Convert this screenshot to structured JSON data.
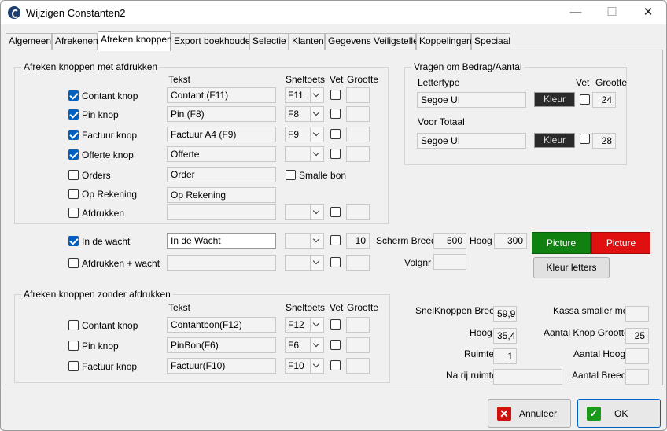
{
  "window": {
    "title": "Wijzigen Constanten2",
    "minimize": "—",
    "maximize": "☐",
    "close": "✕"
  },
  "tabs": [
    "Algemeen",
    "Afrekenen",
    "Afreken knoppen",
    "Export boekhouden",
    "Selectie",
    "Klanten",
    "Gegevens Veiligstellen",
    "Koppelingen",
    "Speciaal"
  ],
  "group1": {
    "title": "Afreken knoppen met afdrukken",
    "headers": {
      "tekst": "Tekst",
      "sneltoets": "Sneltoets",
      "vet": "Vet",
      "grootte": "Grootte"
    },
    "rows": [
      {
        "label": "Contant knop",
        "checked": true,
        "tekst": "Contant (F11)",
        "sneltoets": "F11"
      },
      {
        "label": "Pin knop",
        "checked": true,
        "tekst": "Pin (F8)",
        "sneltoets": "F8"
      },
      {
        "label": "Factuur knop",
        "checked": true,
        "tekst": "Factuur A4 (F9)",
        "sneltoets": "F9"
      },
      {
        "label": "Offerte knop",
        "checked": true,
        "tekst": "Offerte",
        "sneltoets": ""
      },
      {
        "label": "Orders",
        "checked": false,
        "tekst": "Order",
        "smalle_bon": "Smalle bon"
      },
      {
        "label": "Op Rekening",
        "checked": false,
        "tekst": "Op Rekening"
      },
      {
        "label": "Afdrukken",
        "checked": false,
        "tekst": "",
        "sneltoets": ""
      }
    ]
  },
  "wacht": {
    "row1": {
      "label": "In de wacht",
      "checked": true,
      "tekst": "In de Wacht",
      "grootte": "10"
    },
    "row2": {
      "label": "Afdrukken + wacht",
      "checked": false,
      "tekst": ""
    },
    "scherm_breed_label": "Scherm Breed",
    "scherm_breed": "500",
    "hoog_label": "Hoog",
    "hoog": "300",
    "volgnr_label": "Volgnr",
    "volgnr": "",
    "picture1": "Picture",
    "picture2": "Picture",
    "kleur_letters": "Kleur letters"
  },
  "vragen": {
    "title": "Vragen om Bedrag/Aantal",
    "lettertype_label": "Lettertype",
    "vet": "Vet",
    "grootte": "Grootte",
    "font1": "Segoe UI",
    "kleur1": "Kleur",
    "size1": "24",
    "voor_totaal_label": "Voor Totaal",
    "font2": "Segoe UI",
    "kleur2": "Kleur",
    "size2": "28"
  },
  "group2": {
    "title": "Afreken knoppen zonder afdrukken",
    "headers": {
      "tekst": "Tekst",
      "sneltoets": "Sneltoets",
      "vet": "Vet",
      "grootte": "Grootte"
    },
    "rows": [
      {
        "label": "Contant knop",
        "checked": false,
        "tekst": "Contantbon(F12)",
        "sneltoets": "F12"
      },
      {
        "label": "Pin knop",
        "checked": false,
        "tekst": "PinBon(F6)",
        "sneltoets": "F6"
      },
      {
        "label": "Factuur knop",
        "checked": false,
        "tekst": "Factuur(F10)",
        "sneltoets": "F10"
      }
    ]
  },
  "snel": {
    "breed_label": "SnelKnoppen Breed",
    "breed": "59,9",
    "hoog_label": "Hoog",
    "hoog": "35,4",
    "ruimte_label": "Ruimte",
    "ruimte": "1",
    "na_rij_label": "Na rij ruimte",
    "na_rij": "",
    "kassa_label": "Kassa smaller met",
    "kassa": "",
    "aantal_knop_label": "Aantal Knop Grootte",
    "aantal_knop": "25",
    "aantal_hoog_label": "Aantal Hoog",
    "aantal_hoog": "",
    "aantal_breed_label": "Aantal Breed",
    "aantal_breed": ""
  },
  "buttons": {
    "annuleer": "Annuleer",
    "ok": "OK"
  },
  "colors": {
    "picture1": "#108010",
    "picture2": "#e01010",
    "kleur_box": "#2a2a2a",
    "check": "#0060c0"
  }
}
